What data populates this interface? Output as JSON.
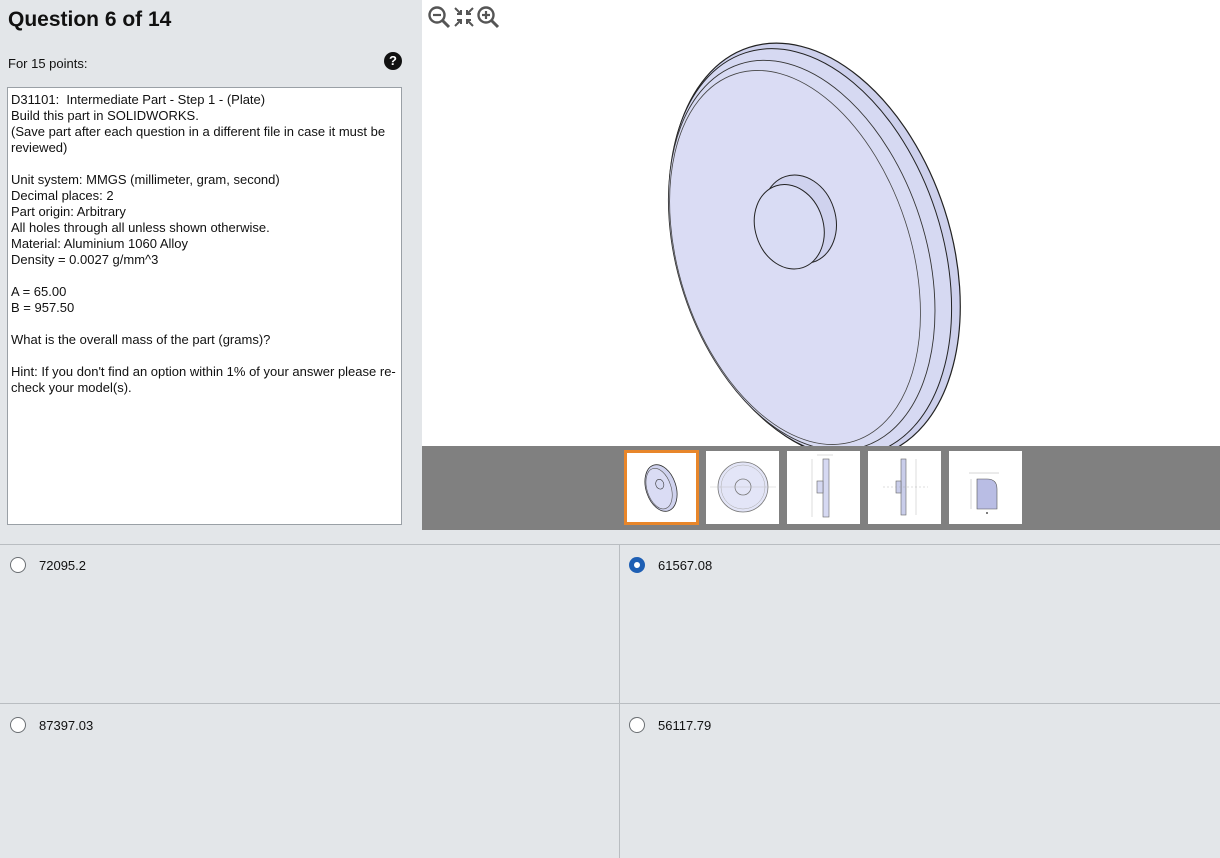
{
  "question": {
    "title": "Question 6 of 14",
    "points": "For 15 points:",
    "text": "D31101:  Intermediate Part - Step 1 - (Plate)\nBuild this part in SOLIDWORKS.\n(Save part after each question in a different file in case it must be reviewed)\n\nUnit system: MMGS (millimeter, gram, second)\nDecimal places: 2\nPart origin: Arbitrary\nAll holes through all unless shown otherwise.\nMaterial: Aluminium 1060 Alloy\nDensity = 0.0027 g/mm^3\n\nA = 65.00\nB = 957.50\n\nWhat is the overall mass of the part (grams)?\n\nHint: If you don't find an option within 1% of your answer please re-check your model(s)."
  },
  "viewer": {
    "tools": [
      "zoom-out-icon",
      "fit-to-window-icon",
      "zoom-in-icon"
    ],
    "thumbnails": [
      {
        "name": "isometric-view",
        "selected": true
      },
      {
        "name": "front-view",
        "selected": false
      },
      {
        "name": "side-view",
        "selected": false
      },
      {
        "name": "section-view",
        "selected": false
      },
      {
        "name": "detail-view",
        "selected": false
      }
    ],
    "accent": "#e8862a",
    "part_color": "#d6d9f2"
  },
  "answers": [
    {
      "label": "72095.2",
      "selected": false
    },
    {
      "label": "61567.08",
      "selected": true
    },
    {
      "label": "87397.03",
      "selected": false
    },
    {
      "label": "56117.79",
      "selected": false
    }
  ],
  "colors": {
    "radio_selected": "#1e5fb4",
    "panel_bg": "#e3e6e9"
  }
}
